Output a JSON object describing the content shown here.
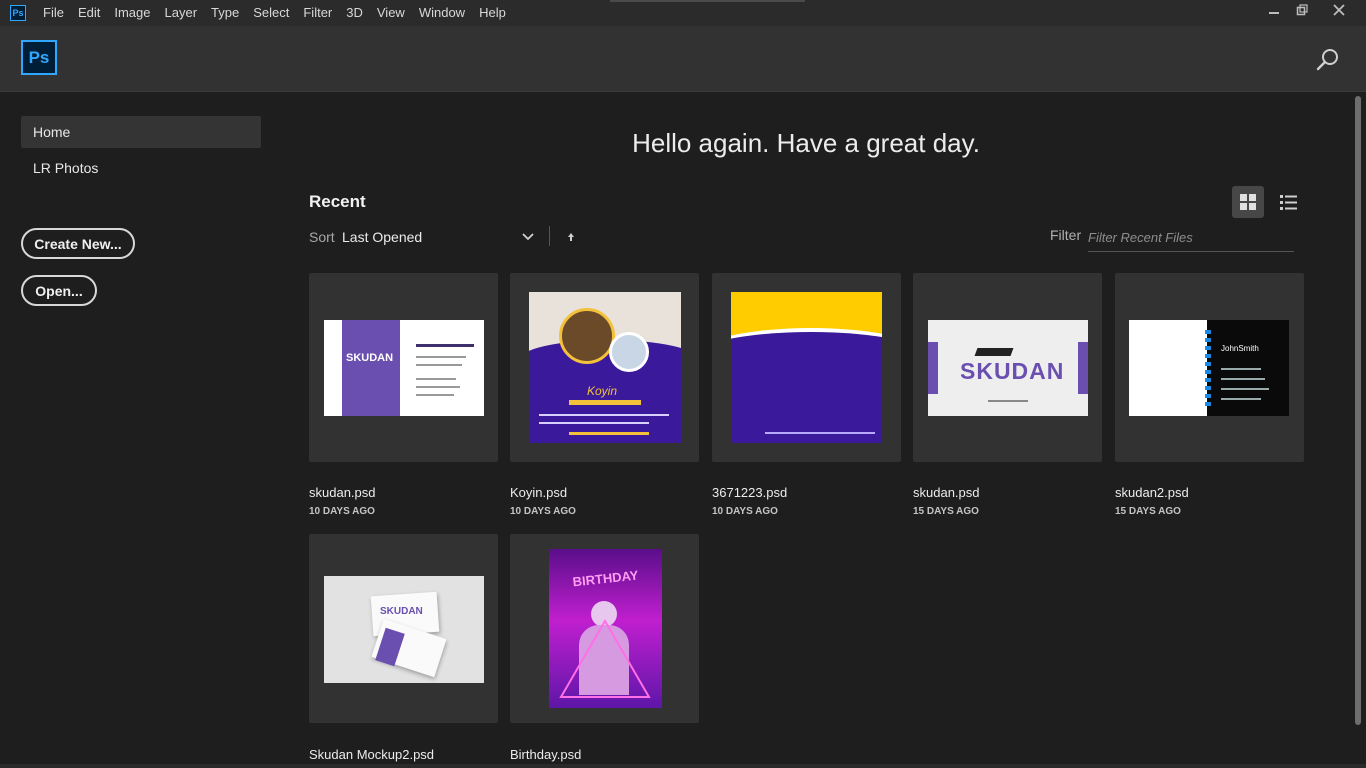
{
  "menubar": {
    "app_icon": "Ps",
    "items": [
      "File",
      "Edit",
      "Image",
      "Layer",
      "Type",
      "Select",
      "Filter",
      "3D",
      "View",
      "Window",
      "Help"
    ],
    "window_controls": [
      "minimize-icon",
      "restore-icon",
      "close-icon"
    ]
  },
  "header": {
    "logo": "Ps",
    "search_icon": "search-icon"
  },
  "sidebar": {
    "items": [
      {
        "label": "Home",
        "active": true
      },
      {
        "label": "LR Photos",
        "active": false
      }
    ],
    "create_new_label": "Create New...",
    "open_label": "Open..."
  },
  "main": {
    "greeting": "Hello again. Have a great day.",
    "recent_title": "Recent",
    "sort_label": "Sort",
    "sort_value": "Last Opened",
    "filter_label": "Filter",
    "filter_placeholder": "Filter Recent Files",
    "view_modes": [
      "grid-view-icon",
      "list-view-icon"
    ],
    "active_view": "grid"
  },
  "files": [
    {
      "name": "skudan.psd",
      "date": "10 DAYS AGO",
      "thumb_text": "SKUDAN"
    },
    {
      "name": "Koyin.psd",
      "date": "10 DAYS AGO",
      "thumb_text": "Koyin"
    },
    {
      "name": "3671223.psd",
      "date": "10 DAYS AGO",
      "thumb_text": ""
    },
    {
      "name": "skudan.psd",
      "date": "15 DAYS AGO",
      "thumb_text": "SKUDAN"
    },
    {
      "name": "skudan2.psd",
      "date": "15 DAYS AGO",
      "thumb_text": "JohnSmith"
    },
    {
      "name": "Skudan Mockup2.psd",
      "date": "",
      "thumb_text": "SKUDAN"
    },
    {
      "name": "Birthday.psd",
      "date": "",
      "thumb_text": "BIRTHDAY"
    }
  ],
  "colors": {
    "accent": "#31a8ff",
    "purple": "#6a4fb0",
    "indigo": "#3a1a9a",
    "yellow": "#ffcc00"
  }
}
